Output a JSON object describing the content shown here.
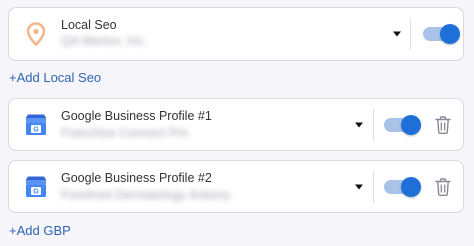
{
  "local_seo_card": {
    "title": "Local Seo",
    "subtitle": "QA Mentor, Inc.",
    "toggle_on": true,
    "icon": "location-pin-icon"
  },
  "add_local_seo": {
    "label": "+Add Local Seo"
  },
  "gbp_cards": [
    {
      "title": "Google Business Profile #1",
      "subtitle": "Franchise Connect Pro",
      "toggle_on": true,
      "icon": "google-business-profile-icon"
    },
    {
      "title": "Google Business Profile #2",
      "subtitle": "Forefront Dermatology Ankeny",
      "toggle_on": true,
      "icon": "google-business-profile-icon"
    }
  ],
  "add_gbp": {
    "label": "+Add GBP"
  },
  "colors": {
    "accent": "#1f6fd8",
    "toggle_track": "#a9c2e8",
    "link": "#2f63b3",
    "pin": "#f5b48a"
  }
}
